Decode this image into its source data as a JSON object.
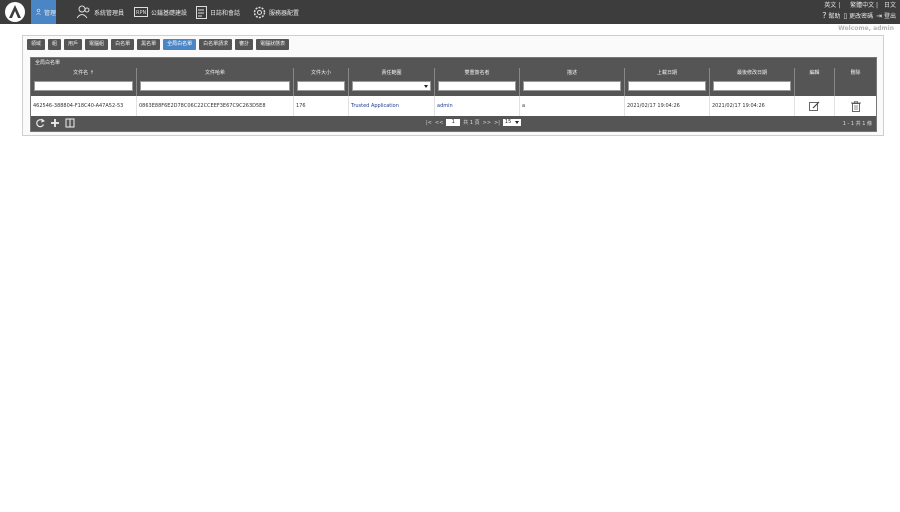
{
  "topbar": {
    "nav": [
      {
        "label": "管理",
        "icon": "user-gear-icon"
      },
      {
        "label": "系統管理員",
        "icon": "users-icon"
      },
      {
        "label": "公鑰基礎建設",
        "icon": "pki-icon"
      },
      {
        "label": "日誌和會話",
        "icon": "log-icon"
      },
      {
        "label": "服務器配置",
        "icon": "gear-icon"
      }
    ],
    "languages": [
      "英文",
      "繁體中文",
      "日文"
    ],
    "actions": [
      {
        "label": "幫助",
        "icon": "help-icon"
      },
      {
        "label": "更改密碼",
        "icon": "phone-icon"
      },
      {
        "label": "登出",
        "icon": "logout-icon"
      }
    ],
    "welcome": "Welcome, admin"
  },
  "tabs": [
    {
      "label": "領域"
    },
    {
      "label": "組"
    },
    {
      "label": "用戶"
    },
    {
      "label": "電腦組"
    },
    {
      "label": "白名單"
    },
    {
      "label": "黑名單"
    },
    {
      "label": "全局白名單",
      "active": true
    },
    {
      "label": "白名單請求"
    },
    {
      "label": "審計"
    },
    {
      "label": "電腦狀態表"
    }
  ],
  "grid": {
    "title": "全局白名單",
    "columns": [
      "文件名 ↑",
      "文件哈希",
      "文件大小",
      "責任範圍",
      "雙重簽名者",
      "描述",
      "上載日期",
      "最後修改日期",
      "編輯",
      "刪除"
    ],
    "row": {
      "filename": "462546-388804-F18C40-A47A52-53",
      "hash": "0863E88F6E2D78C06C22CCEEF3E67C9C263D5E8",
      "size": "176",
      "scope": "Trusted Application",
      "signer": "admin",
      "description": "a",
      "uploaded": "2021/02/17 19:04:26",
      "modified": "2021/02/17 19:04:26"
    },
    "pager": {
      "first": "|<",
      "prev": "<<",
      "page": "1",
      "of_text": "共 1 頁",
      "next": ">>",
      "last": ">|",
      "page_size": "15",
      "summary": "1 - 1 共 1 條"
    }
  }
}
